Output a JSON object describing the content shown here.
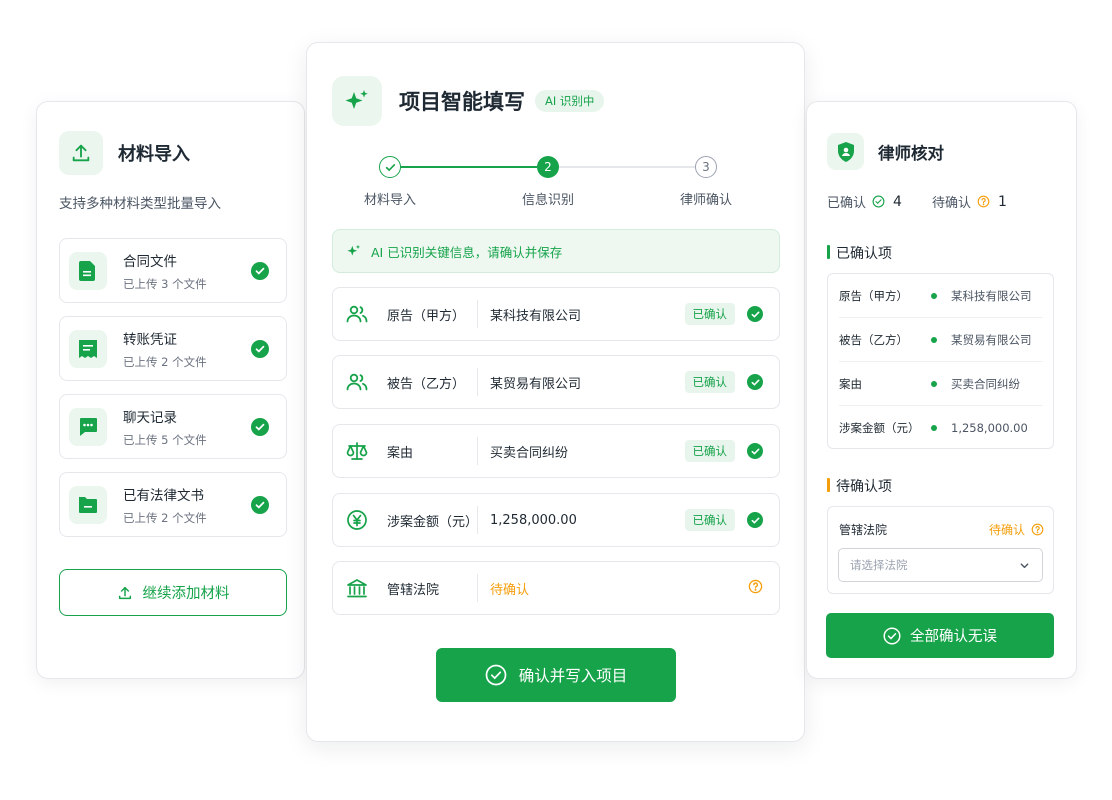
{
  "colors": {
    "accent": "#16a34a",
    "accent_soft": "#eaf6ee",
    "warning": "#f59e0b",
    "border": "#e5e7eb"
  },
  "left": {
    "title": "材料导入",
    "title_icon": "upload-icon",
    "subtitle": "支持多种材料类型批量导入",
    "items": [
      {
        "name": "合同文件",
        "meta": "已上传 3 个文件",
        "icon": "document-icon"
      },
      {
        "name": "转账凭证",
        "meta": "已上传 2 个文件",
        "icon": "receipt-icon"
      },
      {
        "name": "聊天记录",
        "meta": "已上传 5 个文件",
        "icon": "chat-icon"
      },
      {
        "name": "已有法律文书",
        "meta": "已上传 2 个文件",
        "icon": "folder-icon"
      }
    ],
    "add_button": "继续添加材料"
  },
  "center": {
    "title": "项目智能填写",
    "title_icon": "sparkle-icon",
    "badge": "AI 识别中",
    "steps": [
      {
        "number": "1",
        "label": "材料导入",
        "state": "done"
      },
      {
        "number": "2",
        "label": "信息识别",
        "state": "active"
      },
      {
        "number": "3",
        "label": "律师确认",
        "state": "todo"
      }
    ],
    "banner": "AI 已识别关键信息，请确认并保存",
    "fields": [
      {
        "label": "原告（甲方）",
        "value": "某科技有限公司",
        "status": "已确认",
        "icon": "users-icon"
      },
      {
        "label": "被告（乙方）",
        "value": "某贸易有限公司",
        "status": "已确认",
        "icon": "users-icon"
      },
      {
        "label": "案由",
        "value": "买卖合同纠纷",
        "status": "已确认",
        "icon": "scale-icon"
      },
      {
        "label": "涉案金额（元）",
        "value": "1,258,000.00",
        "status": "已确认",
        "icon": "yen-icon"
      },
      {
        "label": "管辖法院",
        "value": "待确认",
        "status": "",
        "icon": "court-icon"
      }
    ],
    "submit_button": "确认并写入项目"
  },
  "right": {
    "title": "律师核对",
    "title_icon": "shield-user-icon",
    "confirmed_label": "已确认",
    "confirmed_count": "4",
    "pending_label": "待确认",
    "pending_count": "1",
    "confirmed_section": "已确认项",
    "confirmed_items": [
      {
        "label": "原告（甲方）",
        "value": "某科技有限公司"
      },
      {
        "label": "被告（乙方）",
        "value": "某贸易有限公司"
      },
      {
        "label": "案由",
        "value": "买卖合同纠纷"
      },
      {
        "label": "涉案金额（元）",
        "value": "1,258,000.00"
      }
    ],
    "pending_section": "待确认项",
    "pending_item": {
      "label": "管辖法院",
      "status": "待确认",
      "placeholder": "请选择法院"
    },
    "confirm_all_button": "全部确认无误"
  }
}
